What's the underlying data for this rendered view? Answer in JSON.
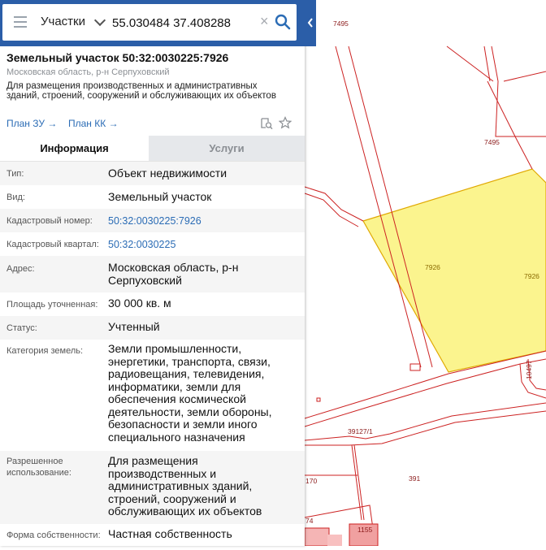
{
  "search": {
    "mode": "Участки",
    "query": "55.030484 37.408288",
    "clear_symbol": "×"
  },
  "parcel": {
    "title": "Земельный участок 50:32:0030225:7926",
    "region": "Московская область, р-н Серпуховский",
    "description": "Для размещения производственных и административных зданий, строений, сооружений и обслуживающих их объектов",
    "links": {
      "plan_zu": "План ЗУ",
      "plan_kk": "План КК",
      "arrow": "→"
    }
  },
  "tabs": {
    "info": "Информация",
    "services": "Услуги"
  },
  "rows": [
    {
      "label": "Тип:",
      "value": "Объект недвижимости"
    },
    {
      "label": "Вид:",
      "value": "Земельный участок"
    },
    {
      "label": "Кадастровый номер:",
      "value": "50:32:0030225:7926"
    },
    {
      "label": "Кадастровый квартал:",
      "value": "50:32:0030225"
    },
    {
      "label": "Адрес:",
      "value": "Московская область, р-н Серпуховский"
    },
    {
      "label": "Площадь уточненная:",
      "value": "30 000 кв. м"
    },
    {
      "label": "Статус:",
      "value": "Учтенный"
    },
    {
      "label": "Категория земель:",
      "value": "Земли промышленности, энергетики, транспорта, связи, радиовещания, телевидения, информатики, земли для обеспечения космической деятельности, земли обороны, безопасности и земли иного специального назначения"
    },
    {
      "label": "Разрешенное использование:",
      "value": "Для размещения производственных и административных зданий, строений, сооружений и обслуживающих их объектов"
    },
    {
      "label": "Форма собственности:",
      "value": "Частная собственность"
    }
  ],
  "map": {
    "labels": {
      "l7495a": "7495",
      "l7495b": "7495",
      "l7926a": "7926",
      "l7926b": "7926",
      "l10497": "10497",
      "l39127": "39127/1",
      "l391": "391",
      "l170": "170",
      "l74": "74",
      "l1155": "1155"
    },
    "colors": {
      "boundary": "#cc2222",
      "parcel_fill": "#fbf48e",
      "parcel_stroke": "#e0a800",
      "header": "#2b5ea8",
      "link": "#2b6cb5"
    }
  }
}
